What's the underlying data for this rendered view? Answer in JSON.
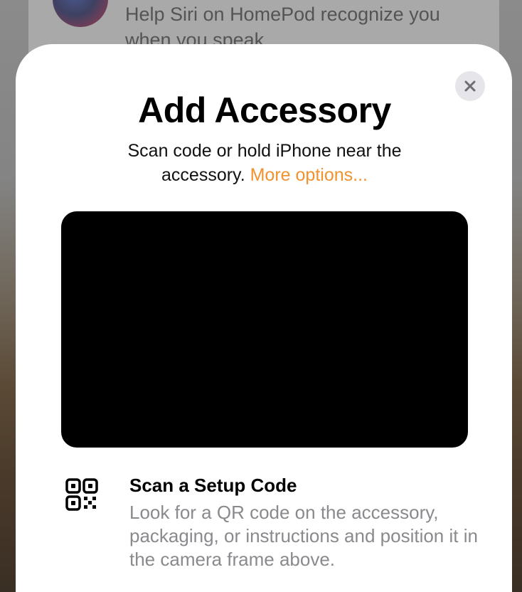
{
  "background_card": {
    "text": "Help Siri on HomePod recognize you when you speak."
  },
  "sheet": {
    "title": "Add Accessory",
    "subtitle_main": "Scan code or hold iPhone near the accessory.",
    "more_options": "More options...",
    "close_icon": "close-x-icon"
  },
  "scan_option": {
    "icon": "qr-code-icon",
    "title": "Scan a Setup Code",
    "description": "Look for a QR code on the accessory, packaging, or instructions and position it in the camera frame above."
  },
  "colors": {
    "accent": "#f0922e",
    "secondary_text": "#8a8a8e",
    "close_bg": "#e6e6ea"
  }
}
